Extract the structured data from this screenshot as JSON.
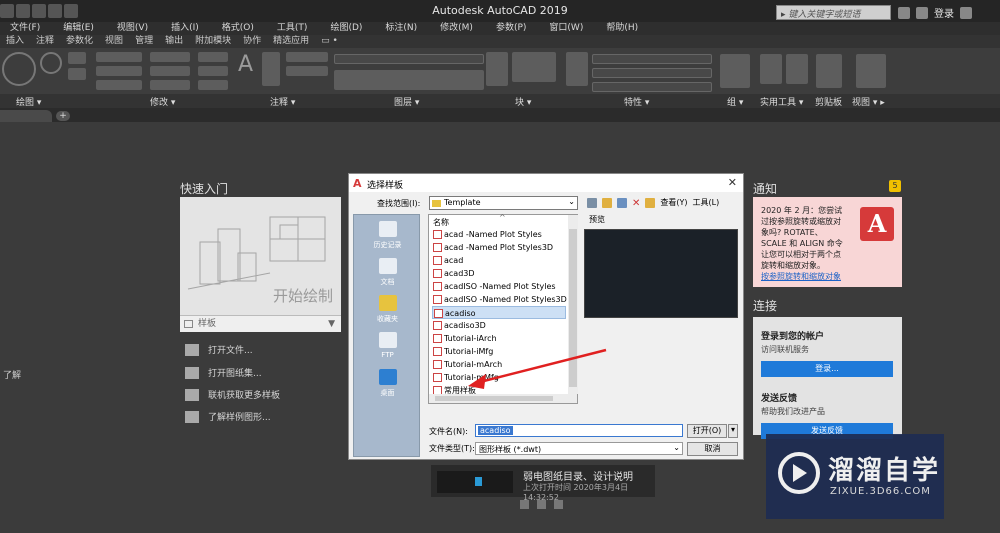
{
  "titlebar": {
    "app_title": "Autodesk AutoCAD 2019",
    "search_placeholder": "键入关键字或短语",
    "login_label": "登录"
  },
  "menu": [
    "文件(F)",
    "编辑(E)",
    "视图(V)",
    "插入(I)",
    "格式(O)",
    "工具(T)",
    "绘图(D)",
    "标注(N)",
    "修改(M)",
    "参数(P)",
    "窗口(W)",
    "帮助(H)"
  ],
  "ribbon_tabs": [
    "插入",
    "注释",
    "参数化",
    "视图",
    "管理",
    "输出",
    "附加模块",
    "协作",
    "精选应用",
    "▭ •"
  ],
  "ribbon_panels": [
    "绘图 ▾",
    "修改 ▾",
    "注释 ▾",
    "图层 ▾",
    "块 ▾",
    "特性 ▾",
    "组 ▾",
    "实用工具 ▾",
    "剪贴板",
    "视图 ▾ ▸"
  ],
  "start": {
    "quickstart_title": "快速入门",
    "start_drawing": "开始绘制",
    "template_label": "样板",
    "links": [
      "打开文件...",
      "打开图纸集...",
      "联机获取更多样板",
      "了解样例图形..."
    ],
    "left_edge": "了解"
  },
  "notice": {
    "title": "通知",
    "badge": "5",
    "body": "2020 年 2 月：您尝试过按参照旋转或缩放对象吗? ROTATE、SCALE 和 ALIGN 命令让您可以相对于两个点旋转和缩放对象。",
    "link": "按参照旋转和缩放对象",
    "logo_letter": "A"
  },
  "connect": {
    "title": "连接",
    "signin_heading": "登录到您的帐户",
    "signin_sub": "访问联机服务",
    "signin_button": "登录...",
    "feedback_heading": "发送反馈",
    "feedback_sub": "帮助我们改进产品",
    "feedback_button": "发送反馈"
  },
  "recent": {
    "name": "弱电图纸目录、设计说明",
    "time": "上次打开时间 2020年3月4日 14:32:52"
  },
  "dialog": {
    "title": "选择样板",
    "close": "✕",
    "lookin_label": "查找范围(I):",
    "lookin_value": "Template",
    "view_label": "查看(Y)",
    "tools_label": "工具(L)",
    "places": [
      "历史记录",
      "文档",
      "收藏夹",
      "FTP",
      "桌面"
    ],
    "column_name": "名称",
    "files": [
      "acad -Named Plot Styles",
      "acad -Named Plot Styles3D",
      "acad",
      "acad3D",
      "acadISO -Named Plot Styles",
      "acadISO -Named Plot Styles3D",
      "acadiso",
      "acadiso3D",
      "Tutorial-iArch",
      "Tutorial-iMfg",
      "Tutorial-mArch",
      "Tutorial-mMfg",
      "常用样板"
    ],
    "preview_label": "预览",
    "filename_label": "文件名(N):",
    "filename_value": "acadiso",
    "filetype_label": "文件类型(T):",
    "filetype_value": "图形样板 (*.dwt)",
    "open_button": "打开(O)",
    "cancel_button": "取消"
  },
  "watermark": {
    "name": "溜溜自学",
    "url": "ZIXUE.3D66.COM"
  },
  "colors": {
    "accent_blue": "#1f7ad9",
    "notice_bg": "#f8d6d6",
    "autocad_red": "#d63a3a",
    "selection": "#cde0f5",
    "arrow_red": "#e02020"
  }
}
